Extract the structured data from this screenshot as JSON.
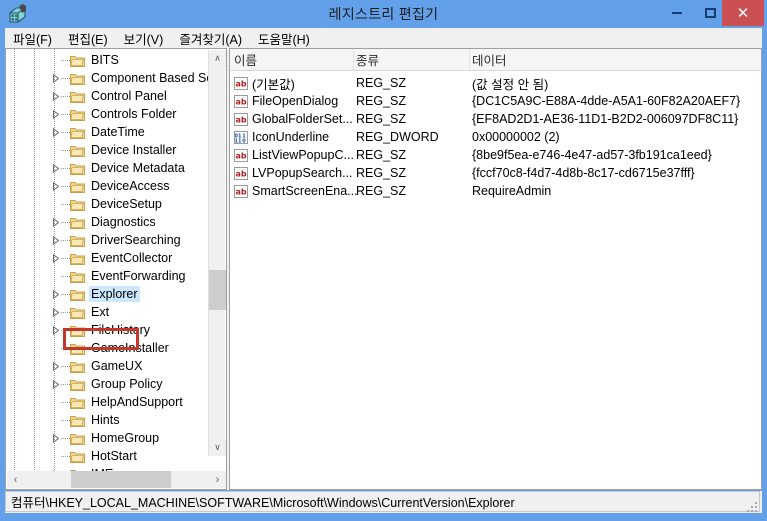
{
  "window": {
    "title": "레지스트리 편집기",
    "icon": "registry-editor-icon",
    "controls": {
      "minimize": "–",
      "maximize": "□",
      "close": "✕"
    },
    "accent_color": "#62a0ea",
    "close_color": "#cb5054"
  },
  "menubar": {
    "items": [
      {
        "label": "파일(F)",
        "name": "menu-file"
      },
      {
        "label": "편집(E)",
        "name": "menu-edit"
      },
      {
        "label": "보기(V)",
        "name": "menu-view"
      },
      {
        "label": "즐겨찾기(A)",
        "name": "menu-favorites"
      },
      {
        "label": "도움말(H)",
        "name": "menu-help"
      }
    ]
  },
  "tree": {
    "items": [
      {
        "label": "BITS",
        "expandable": false,
        "selected": false
      },
      {
        "label": "Component Based Ser",
        "expandable": true,
        "selected": false
      },
      {
        "label": "Control Panel",
        "expandable": true,
        "selected": false
      },
      {
        "label": "Controls Folder",
        "expandable": true,
        "selected": false
      },
      {
        "label": "DateTime",
        "expandable": true,
        "selected": false
      },
      {
        "label": "Device Installer",
        "expandable": false,
        "selected": false
      },
      {
        "label": "Device Metadata",
        "expandable": true,
        "selected": false
      },
      {
        "label": "DeviceAccess",
        "expandable": true,
        "selected": false
      },
      {
        "label": "DeviceSetup",
        "expandable": false,
        "selected": false
      },
      {
        "label": "Diagnostics",
        "expandable": true,
        "selected": false
      },
      {
        "label": "DriverSearching",
        "expandable": true,
        "selected": false
      },
      {
        "label": "EventCollector",
        "expandable": true,
        "selected": false
      },
      {
        "label": "EventForwarding",
        "expandable": false,
        "selected": false
      },
      {
        "label": "Explorer",
        "expandable": true,
        "selected": true
      },
      {
        "label": "Ext",
        "expandable": true,
        "selected": false
      },
      {
        "label": "FileHistory",
        "expandable": true,
        "selected": false
      },
      {
        "label": "GameInstaller",
        "expandable": false,
        "selected": false
      },
      {
        "label": "GameUX",
        "expandable": true,
        "selected": false
      },
      {
        "label": "Group Policy",
        "expandable": true,
        "selected": false
      },
      {
        "label": "HelpAndSupport",
        "expandable": false,
        "selected": false
      },
      {
        "label": "Hints",
        "expandable": false,
        "selected": false
      },
      {
        "label": "HomeGroup",
        "expandable": true,
        "selected": false
      },
      {
        "label": "HotStart",
        "expandable": false,
        "selected": false
      },
      {
        "label": "IME",
        "expandable": true,
        "selected": false
      }
    ],
    "annotation": {
      "highlight_target": "Explorer",
      "highlight_color": "#c0392b",
      "arrow_color": "#cc2222",
      "arrow_direction": "down"
    }
  },
  "list": {
    "columns": [
      {
        "label": "이름",
        "name": "column-name"
      },
      {
        "label": "종류",
        "name": "column-type"
      },
      {
        "label": "데이터",
        "name": "column-data"
      }
    ],
    "rows": [
      {
        "icon": "reg-sz-icon",
        "name": "(기본값)",
        "type": "REG_SZ",
        "data": "(값 설정 안 됨)"
      },
      {
        "icon": "reg-sz-icon",
        "name": "FileOpenDialog",
        "type": "REG_SZ",
        "data": "{DC1C5A9C-E88A-4dde-A5A1-60F82A20AEF7}"
      },
      {
        "icon": "reg-sz-icon",
        "name": "GlobalFolderSet...",
        "type": "REG_SZ",
        "data": "{EF8AD2D1-AE36-11D1-B2D2-006097DF8C11}"
      },
      {
        "icon": "reg-dword-icon",
        "name": "IconUnderline",
        "type": "REG_DWORD",
        "data": "0x00000002 (2)"
      },
      {
        "icon": "reg-sz-icon",
        "name": "ListViewPopupC...",
        "type": "REG_SZ",
        "data": "{8be9f5ea-e746-4e47-ad57-3fb191ca1eed}"
      },
      {
        "icon": "reg-sz-icon",
        "name": "LVPopupSearch...",
        "type": "REG_SZ",
        "data": "{fccf70c8-f4d7-4d8b-8c17-cd6715e37fff}"
      },
      {
        "icon": "reg-sz-icon",
        "name": "SmartScreenEna...",
        "type": "REG_SZ",
        "data": "RequireAdmin"
      }
    ]
  },
  "statusbar": {
    "path": "컴퓨터\\HKEY_LOCAL_MACHINE\\SOFTWARE\\Microsoft\\Windows\\CurrentVersion\\Explorer"
  },
  "scrollbars": {
    "tree_up_arrow": "∧",
    "tree_down_arrow": "∨",
    "tree_left_arrow": "‹",
    "tree_right_arrow": "›"
  }
}
